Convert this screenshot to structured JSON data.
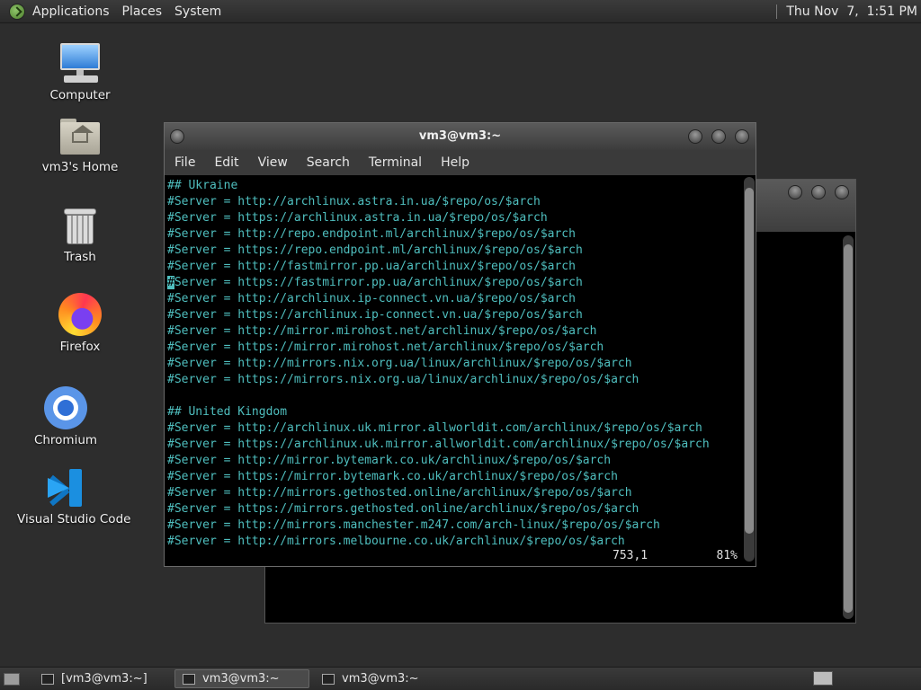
{
  "top_panel": {
    "menus": [
      "Applications",
      "Places",
      "System"
    ],
    "clock": "Thu Nov  7,  1:51 PM"
  },
  "desktop_icons": [
    {
      "label": "Computer",
      "icon": "computer-icon"
    },
    {
      "label": "vm3's Home",
      "icon": "home-folder-icon"
    },
    {
      "label": "Trash",
      "icon": "trash-icon"
    },
    {
      "label": "Firefox",
      "icon": "firefox-icon"
    },
    {
      "label": "Chromium",
      "icon": "chromium-icon"
    },
    {
      "label": "Visual Studio Code",
      "icon": "vscode-icon"
    }
  ],
  "terminal": {
    "title": "vm3@vm3:~",
    "menu": [
      "File",
      "Edit",
      "View",
      "Search",
      "Terminal",
      "Help"
    ],
    "lines": [
      "## Ukraine",
      "#Server = http://archlinux.astra.in.ua/$repo/os/$arch",
      "#Server = https://archlinux.astra.in.ua/$repo/os/$arch",
      "#Server = http://repo.endpoint.ml/archlinux/$repo/os/$arch",
      "#Server = https://repo.endpoint.ml/archlinux/$repo/os/$arch",
      "#Server = http://fastmirror.pp.ua/archlinux/$repo/os/$arch",
      "#Server = https://fastmirror.pp.ua/archlinux/$repo/os/$arch",
      "#Server = http://archlinux.ip-connect.vn.ua/$repo/os/$arch",
      "#Server = https://archlinux.ip-connect.vn.ua/$repo/os/$arch",
      "#Server = http://mirror.mirohost.net/archlinux/$repo/os/$arch",
      "#Server = https://mirror.mirohost.net/archlinux/$repo/os/$arch",
      "#Server = http://mirrors.nix.org.ua/linux/archlinux/$repo/os/$arch",
      "#Server = https://mirrors.nix.org.ua/linux/archlinux/$repo/os/$arch",
      "",
      "## United Kingdom",
      "#Server = http://archlinux.uk.mirror.allworldit.com/archlinux/$repo/os/$arch",
      "#Server = https://archlinux.uk.mirror.allworldit.com/archlinux/$repo/os/$arch",
      "#Server = http://mirror.bytemark.co.uk/archlinux/$repo/os/$arch",
      "#Server = https://mirror.bytemark.co.uk/archlinux/$repo/os/$arch",
      "#Server = http://mirrors.gethosted.online/archlinux/$repo/os/$arch",
      "#Server = https://mirrors.gethosted.online/archlinux/$repo/os/$arch",
      "#Server = http://mirrors.manchester.m247.com/arch-linux/$repo/os/$arch",
      "#Server = http://mirrors.melbourne.co.uk/archlinux/$repo/os/$arch"
    ],
    "cursor_line": 6,
    "status_position": "753,1",
    "status_percent": "81%",
    "text_color": "#4fbfbf"
  },
  "taskbar": {
    "tasks": [
      {
        "label": "[vm3@vm3:~]",
        "active": false
      },
      {
        "label": "vm3@vm3:~",
        "active": true
      },
      {
        "label": "vm3@vm3:~",
        "active": false
      }
    ]
  }
}
